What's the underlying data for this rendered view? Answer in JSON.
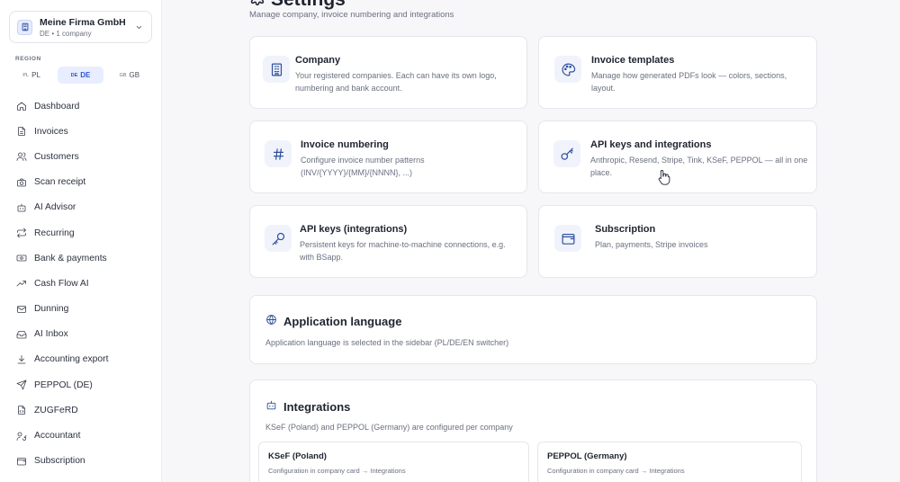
{
  "sidebar": {
    "company": {
      "name": "Meine Firma GmbH",
      "sub": "DE • 1 company"
    },
    "region": {
      "label": "REGION",
      "options": [
        {
          "cc": "PL",
          "label": "PL"
        },
        {
          "cc": "DE",
          "label": "DE",
          "active": true
        },
        {
          "cc": "GB",
          "label": "GB"
        }
      ]
    },
    "nav": [
      {
        "label": "Dashboard",
        "icon": "home-icon"
      },
      {
        "label": "Invoices",
        "icon": "document-icon"
      },
      {
        "label": "Customers",
        "icon": "users-icon"
      },
      {
        "label": "Scan receipt",
        "icon": "camera-icon"
      },
      {
        "label": "AI Advisor",
        "icon": "bot-icon"
      },
      {
        "label": "Recurring",
        "icon": "repeat-icon"
      },
      {
        "label": "Bank & payments",
        "icon": "banknote-icon"
      },
      {
        "label": "Cash Flow AI",
        "icon": "trend-icon"
      },
      {
        "label": "Dunning",
        "icon": "mail-icon"
      },
      {
        "label": "AI Inbox",
        "icon": "inbox-icon"
      },
      {
        "label": "Accounting export",
        "icon": "download-icon"
      },
      {
        "label": "PEPPOL (DE)",
        "icon": "send-icon"
      },
      {
        "label": "ZUGFeRD",
        "icon": "file-code-icon"
      },
      {
        "label": "Accountant",
        "icon": "user-key-icon"
      },
      {
        "label": "Subscription",
        "icon": "wallet-icon"
      }
    ]
  },
  "header": {
    "title": "Settings",
    "subtitle": "Manage company, invoice numbering and integrations"
  },
  "cards": {
    "company": {
      "title": "Company",
      "desc": "Your registered companies. Each can have its own logo, numbering and bank account."
    },
    "templates": {
      "title": "Invoice templates",
      "desc": "Manage how generated PDFs look — colors, sections, layout."
    },
    "numbering": {
      "title": "Invoice numbering",
      "desc": "Configure invoice number patterns (INV/{YYYY}/{MM}/{NNNN}, ...)"
    },
    "api_integrations": {
      "title": "API keys and integrations",
      "desc": "Anthropic, Resend, Stripe, Tink, KSeF, PEPPOL — all in one place."
    },
    "api_keys": {
      "title": "API keys (integrations)",
      "desc": "Persistent keys for machine-to-machine connections, e.g. with BSapp."
    },
    "subscription": {
      "title": "Subscription",
      "desc": "Plan, payments, Stripe invoices"
    }
  },
  "language": {
    "title": "Application language",
    "desc": "Application language is selected in the sidebar (PL/DE/EN switcher)"
  },
  "integrations": {
    "title": "Integrations",
    "desc": "KSeF (Poland) and PEPPOL (Germany) are configured per company",
    "items": [
      {
        "title": "KSeF (Poland)",
        "desc": "Configuration in company card → Integrations"
      },
      {
        "title": "PEPPOL (Germany)",
        "desc": "Configuration in company card → Integrations"
      }
    ]
  },
  "colors": {
    "accent": "#2f54d6",
    "icon": "#2f4f9e",
    "muted": "#6b7080"
  }
}
